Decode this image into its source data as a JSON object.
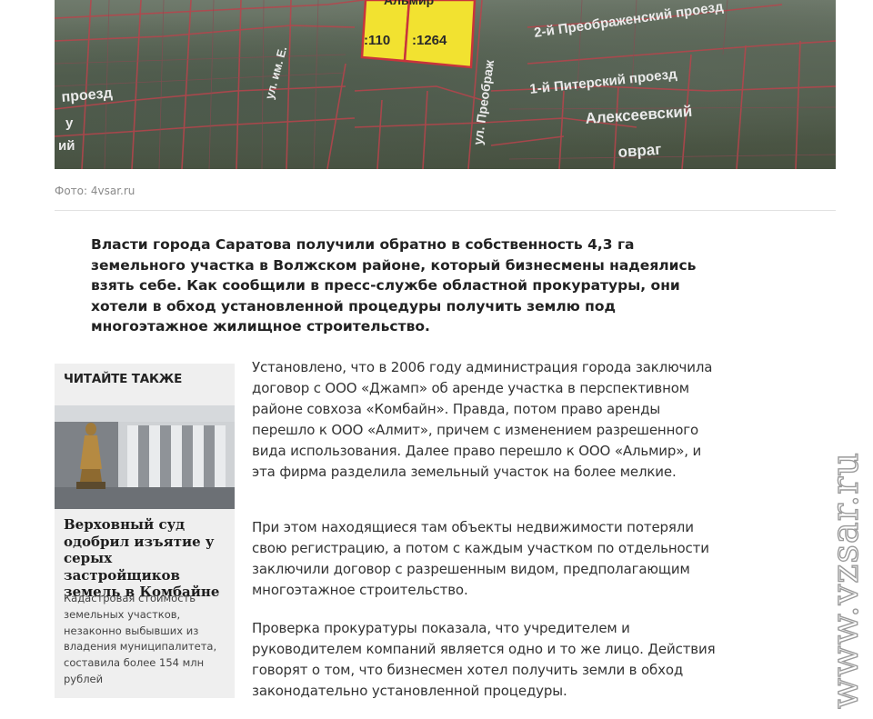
{
  "hero": {
    "map_labels": {
      "preobr_2": "2-й Преображенский проезд",
      "piter_1": "1-й Питерский проезд",
      "alekseevsky": "Алексеевский",
      "ovrag": "овраг",
      "ul_preobr": "ул. Преображ",
      "proezd": "проезд",
      "almir": "Альмир",
      "plot_110": ":110",
      "plot_1264": ":1264",
      "ul_im": "ул. им. Е.",
      "y": "у",
      "iy": "ий"
    }
  },
  "caption": "Фото: 4vsar.ru",
  "lead": "Власти города Саратова получили обратно в собственность 4,3 га земельного участка в Волжском районе, который бизнесмены надеялись взять себе. Как сообщили в пресс-службе областной прокуратуры, они хотели в обход установленной процедуры получить землю под многоэтажное жилищное строительство.",
  "read_also": {
    "heading": "ЧИТАЙТЕ ТАКЖЕ",
    "title": "Верховный суд одобрил изъятие у серых застройщиков земель в Комбайне",
    "description": "Кадастровая стоимость земельных участков, незаконно выбывших из владения муниципалитета, составила более 154 млн рублей"
  },
  "paragraphs": [
    "Установлено, что в 2006 году администрация города заключила договор с ООО «Джамп» об аренде участка в перспективном районе совхоза «Комбайн». Правда, потом право аренды перешло к ООО «Алмит», причем с изменением разрешенного вида использования. Далее право перешло к ООО «Альмир», и эта фирма разделила земельный участок на более мелкие.",
    "При этом находящиеся там объекты недвижимости потеряли свою регистрацию, а потом с каждым участком по отдельности заключили договор с разрешенным видом, предполагающим многоэтажное строительство.",
    "Проверка прокуратуры показала, что учредителем и руководителем компаний является одно и то же лицо. Действия говорят о том, что бизнесмен хотел получить земли в обход законодательно установленной процедуры."
  ],
  "watermark": "www.vzsar.ru",
  "colors": {
    "plot_yellow": "#f2e230",
    "boundary_red": "#c8343c",
    "card_bg": "#efefef",
    "caption_gray": "#8a8a8a"
  }
}
